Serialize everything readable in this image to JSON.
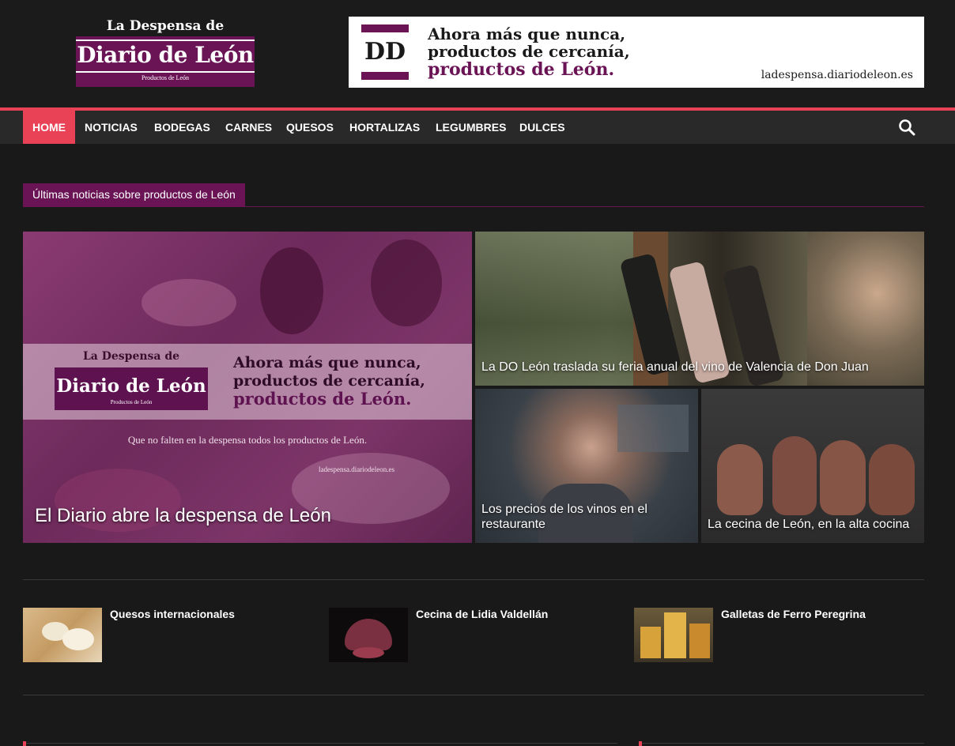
{
  "header": {
    "logo": {
      "top": "La Despensa de",
      "main": "Diario de León",
      "sub": "Productos de León"
    },
    "banner": {
      "mark": "DD",
      "line1": "Ahora más que nunca,",
      "line2": "productos de cercanía,",
      "line3": "productos de León.",
      "url": "ladespensa.diariodeleon.es"
    }
  },
  "nav": {
    "items": [
      {
        "label": "HOME"
      },
      {
        "label": "NOTICIAS"
      },
      {
        "label": "BODEGAS"
      },
      {
        "label": "CARNES"
      },
      {
        "label": "QUESOS"
      },
      {
        "label": "HORTALIZAS"
      },
      {
        "label": "LEGUMBRES"
      },
      {
        "label": "DULCES"
      }
    ],
    "search_icon": "search-icon"
  },
  "section": {
    "title": "Últimas noticias sobre productos de León"
  },
  "featured": {
    "main": {
      "title": "El Diario abre la despensa de León",
      "image": {
        "logo_top": "La Despensa de",
        "logo_main": "Diario de León",
        "logo_sub": "Productos de León",
        "line1": "Ahora más que nunca,",
        "line2": "productos de cercanía,",
        "line3": "productos de León.",
        "tagline": "Que no falten en la despensa todos los productos de León.",
        "url": "ladespensa.diariodeleon.es"
      }
    },
    "top_right": {
      "title": "La DO León traslada su feria anual del vino de Valencia de Don Juan"
    },
    "bottom_left": {
      "title": "Los precios de los vinos en el restaurante"
    },
    "bottom_right": {
      "title": "La cecina de León, en la alta cocina"
    }
  },
  "posts": [
    {
      "title": "Quesos internacionales"
    },
    {
      "title": "Cecina de Lidia Valdellán"
    },
    {
      "title": "Galletas de Ferro Peregrina"
    }
  ],
  "colors": {
    "accent": "#e94256",
    "brand": "#6a1456",
    "background": "#1a1919"
  }
}
